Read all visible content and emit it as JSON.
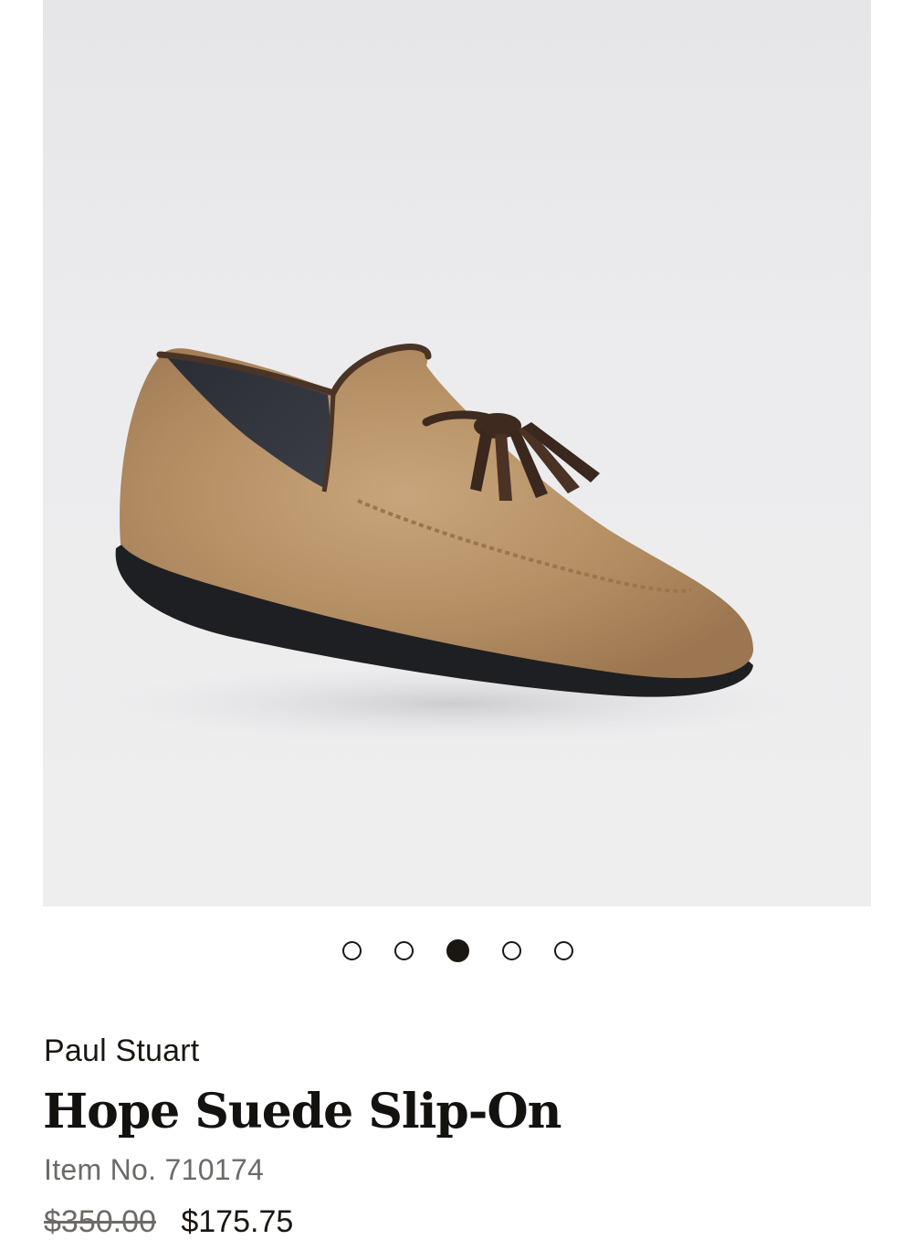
{
  "product_image": {
    "alt": "Hope Suede Slip-On"
  },
  "carousel": {
    "count": 5,
    "active_index": 2
  },
  "product": {
    "brand": "Paul Stuart",
    "title": "Hope Suede Slip-On",
    "item_no": "Item No. 710174",
    "original_price": "$350.00",
    "sale_price": "$175.75"
  },
  "colors": {
    "text_dark": "#1a1712",
    "text_muted": "#6d6a66",
    "image_bg": "#ececee",
    "suede": "#b58f64",
    "tassel": "#3e2a1f",
    "sole": "#1d1f22"
  }
}
